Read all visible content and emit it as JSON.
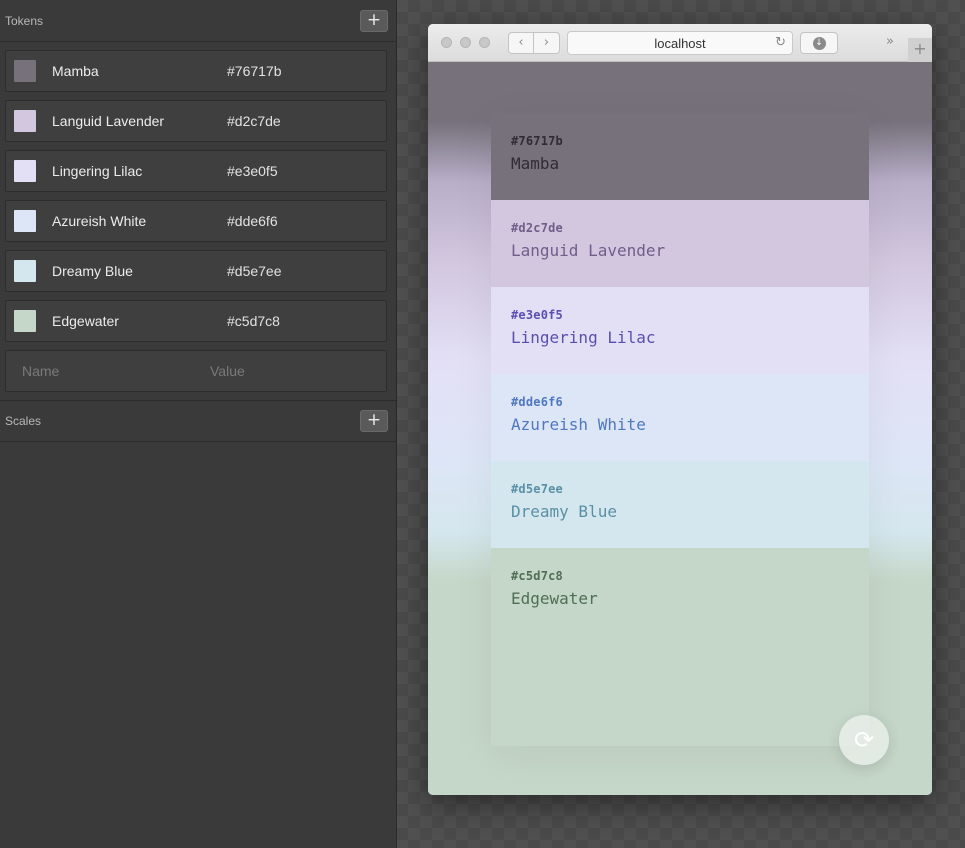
{
  "panel": {
    "tokens_header": "Tokens",
    "scales_header": "Scales",
    "add_label": "+",
    "tokens": [
      {
        "name": "Mamba",
        "value": "#76717b"
      },
      {
        "name": "Languid Lavender",
        "value": "#d2c7de"
      },
      {
        "name": "Lingering Lilac",
        "value": "#e3e0f5"
      },
      {
        "name": "Azureish White",
        "value": "#dde6f6"
      },
      {
        "name": "Dreamy Blue",
        "value": "#d5e7ee"
      },
      {
        "name": "Edgewater",
        "value": "#c5d7c8"
      }
    ],
    "new_token": {
      "name_placeholder": "Name",
      "value_placeholder": "Value"
    }
  },
  "browser": {
    "address": "localhost",
    "back_icon": "‹",
    "forward_icon": "›",
    "reload_icon": "↻",
    "download_icon": "↓",
    "more_icon": "»",
    "newtab_icon": "+"
  },
  "preview": {
    "cards": [
      {
        "hex": "#76717b",
        "name": "Mamba",
        "bg": "#76717b",
        "hex_color": "#2f2c33",
        "name_color": "#2f2c33"
      },
      {
        "hex": "#d2c7de",
        "name": "Languid Lavender",
        "bg": "#d2c7de",
        "hex_color": "#6f5d8a",
        "name_color": "#6f5d8a"
      },
      {
        "hex": "#e3e0f5",
        "name": "Lingering Lilac",
        "bg": "#e3e0f5",
        "hex_color": "#5a4fb0",
        "name_color": "#5a4fb0"
      },
      {
        "hex": "#dde6f6",
        "name": "Azureish White",
        "bg": "#dde6f6",
        "hex_color": "#4f78bf",
        "name_color": "#4f78bf"
      },
      {
        "hex": "#d5e7ee",
        "name": "Dreamy Blue",
        "bg": "#d5e7ee",
        "hex_color": "#5a8fa6",
        "name_color": "#5a8fa6"
      },
      {
        "hex": "#c5d7c8",
        "name": "Edgewater",
        "bg": "#c5d7c8",
        "hex_color": "#4f6e55",
        "name_color": "#4f6e55"
      }
    ],
    "refresh_icon": "⟳"
  }
}
